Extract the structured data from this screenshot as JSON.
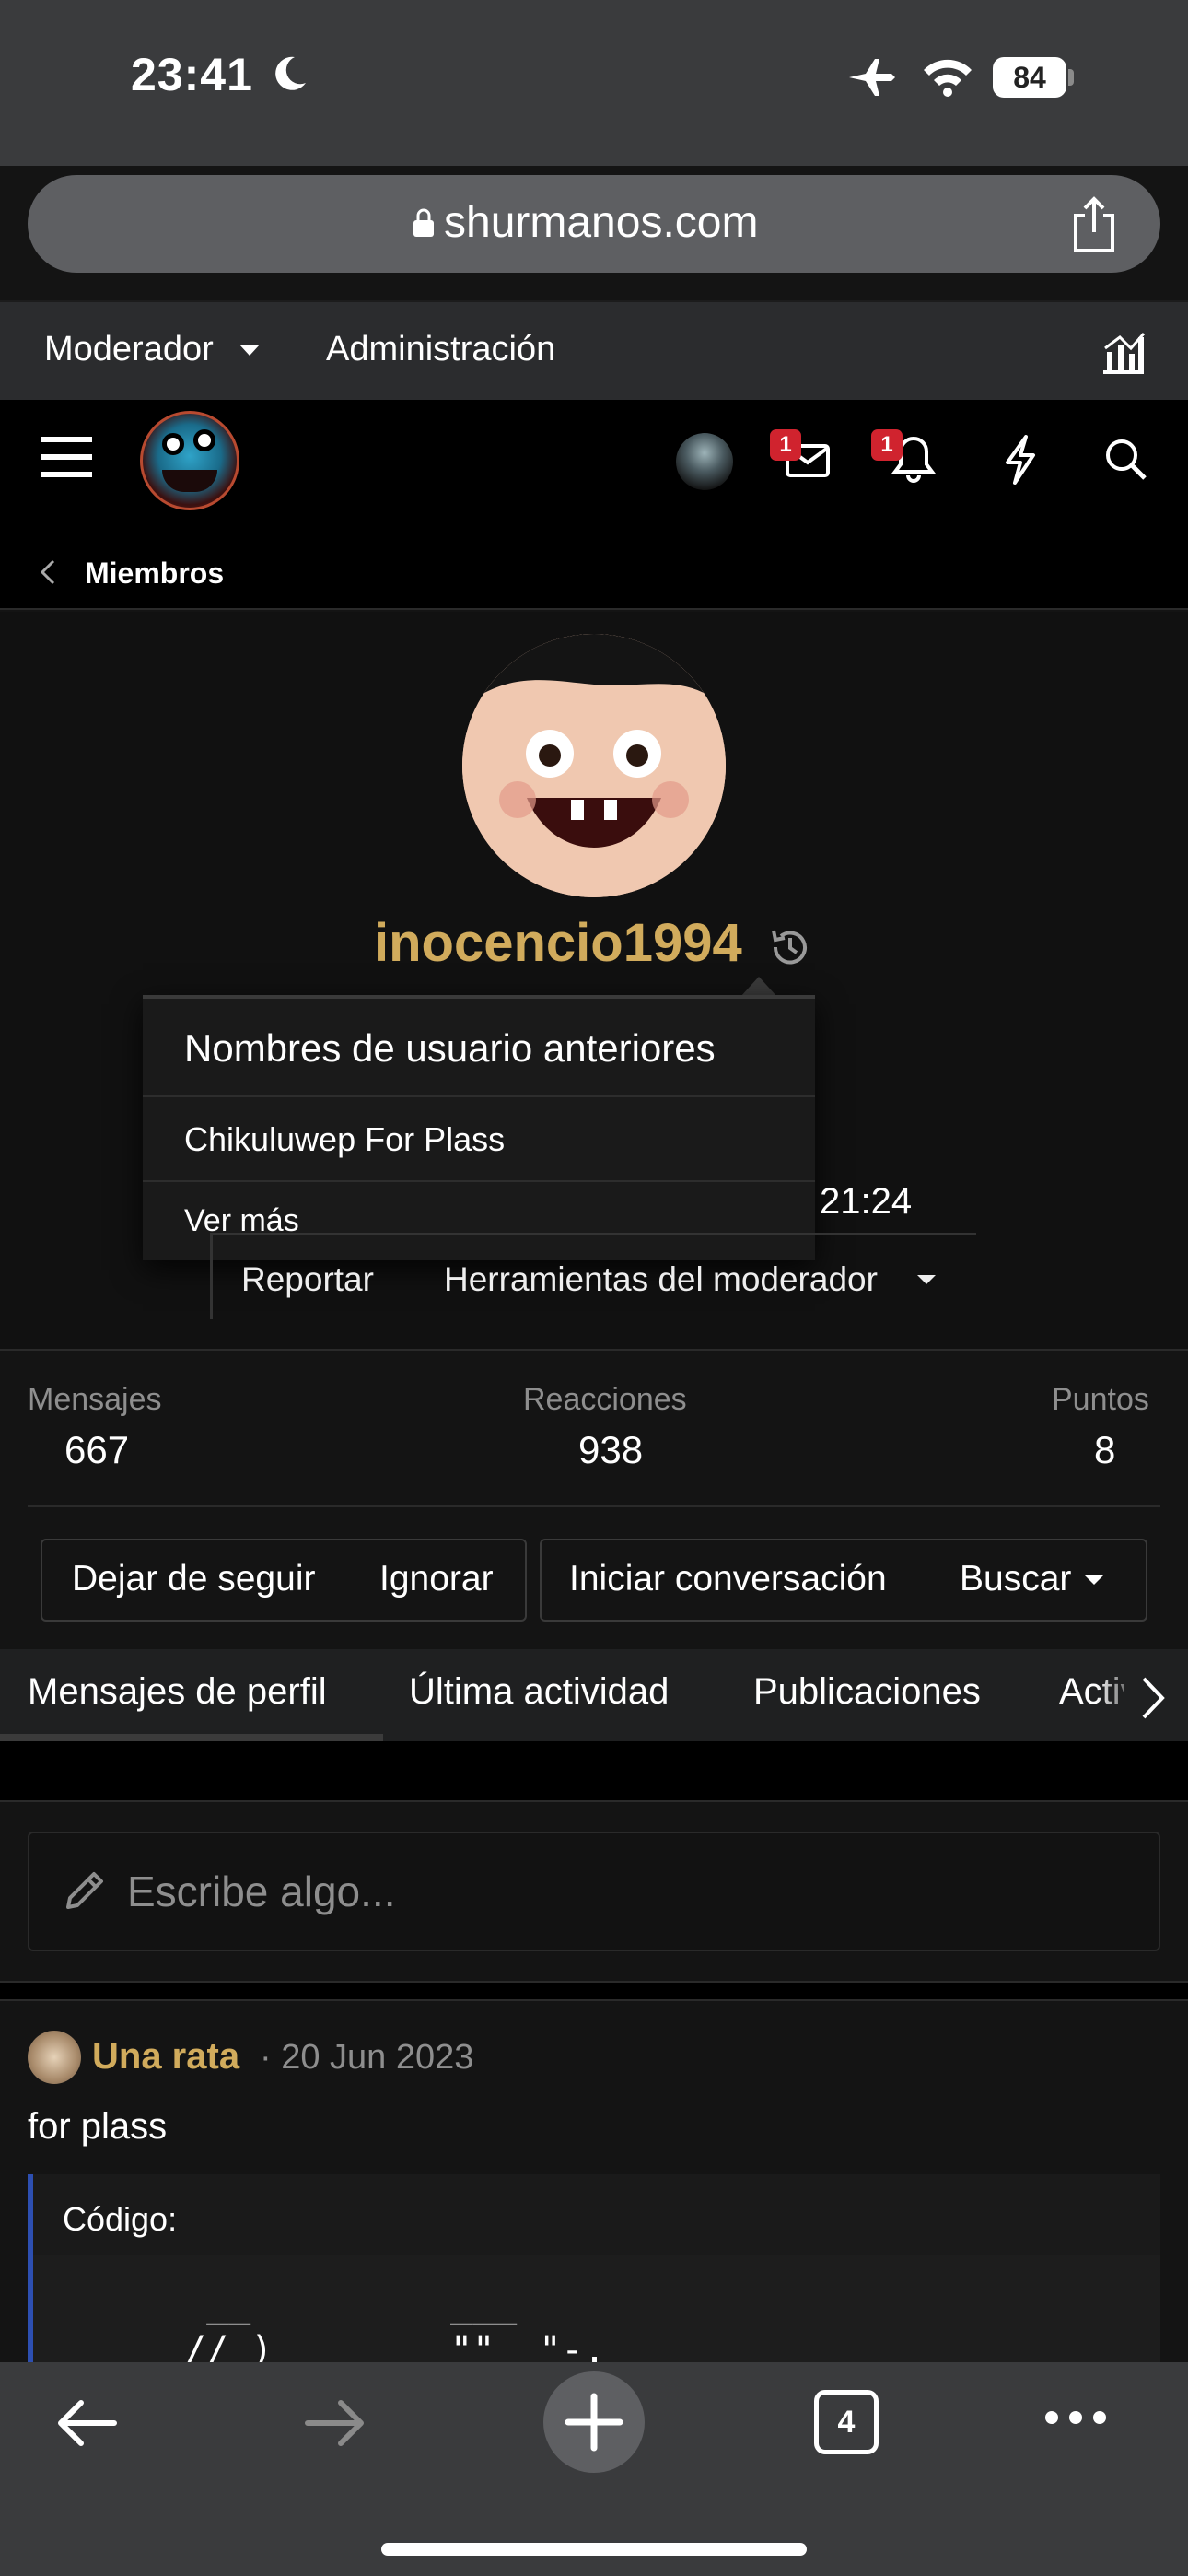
{
  "status_bar": {
    "time": "23:41",
    "battery": "84"
  },
  "browser": {
    "url": "shurmanos.com",
    "open_tabs": "4"
  },
  "mod_bar": {
    "moderator_label": "Moderador",
    "admin_label": "Administración"
  },
  "header": {
    "inbox_badge": "1",
    "alerts_badge": "1"
  },
  "breadcrumb": {
    "label": "Miembros"
  },
  "profile": {
    "username": "inocencio1994",
    "popover": {
      "title": "Nombres de usuario anteriores",
      "item": "Chikuluwep For Plass",
      "more": "Ver más"
    },
    "partial_time": "21:24",
    "report_label": "Reportar",
    "mod_tools_label": "Herramientas del moderador"
  },
  "stats": {
    "messages_label": "Mensajes",
    "messages_value": "667",
    "reactions_label": "Reacciones",
    "reactions_value": "938",
    "points_label": "Puntos",
    "points_value": "8"
  },
  "buttons": {
    "unfollow": "Dejar de seguir",
    "ignore": "Ignorar",
    "conversation": "Iniciar conversación",
    "search": "Buscar"
  },
  "tabs": [
    "Mensajes de perfil",
    "Última actividad",
    "Publicaciones",
    "Actividad"
  ],
  "compose": {
    "placeholder": "Escribe algo..."
  },
  "post": {
    "author": "Una rata",
    "date": "· 20 Jun 2023",
    "body": "for plass",
    "code_label": "Código:",
    "code_text": " __         ___\n// )      __\"\"  \"-."
  },
  "colors": {
    "username": "#d1ab5c",
    "badge": "#d0232e",
    "code_border": "#2d4fb1"
  }
}
